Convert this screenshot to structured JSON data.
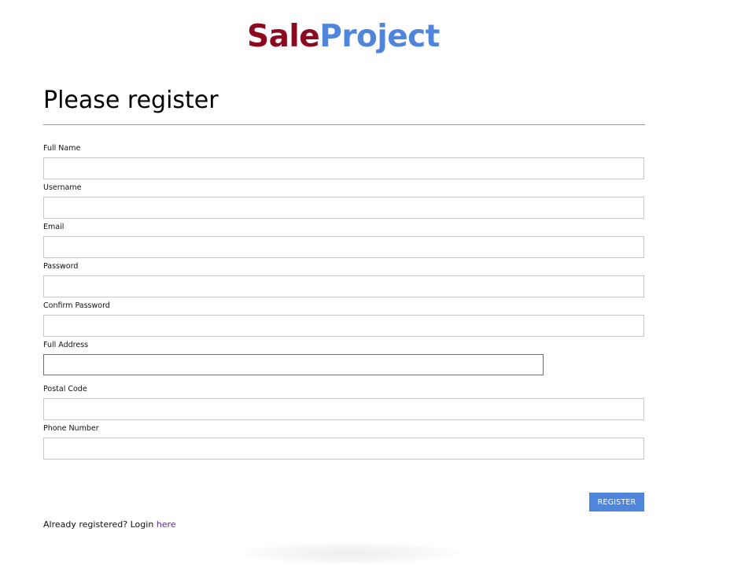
{
  "logo": {
    "part1": "Sale",
    "part2": "Project",
    "color1": "#8b0a1f",
    "color2": "#4f86dc"
  },
  "page_title": "Please register",
  "form": {
    "fields": [
      {
        "label": "Full Name",
        "value": "",
        "focused": false
      },
      {
        "label": "Username",
        "value": "",
        "focused": false
      },
      {
        "label": "Email",
        "value": "",
        "focused": false
      },
      {
        "label": "Password",
        "value": "",
        "focused": false
      },
      {
        "label": "Confirm Password",
        "value": "",
        "focused": false
      },
      {
        "label": "Full Address",
        "value": "",
        "focused": true
      },
      {
        "label": "Postal Code",
        "value": "",
        "focused": false
      },
      {
        "label": "Phone Number",
        "value": "",
        "focused": false
      }
    ],
    "submit_label": "REGISTER",
    "button_color": "#4f86dc"
  },
  "login_prompt": {
    "text": "Already registered? Login",
    "link_text": "here",
    "link_color": "#5a2d91"
  }
}
